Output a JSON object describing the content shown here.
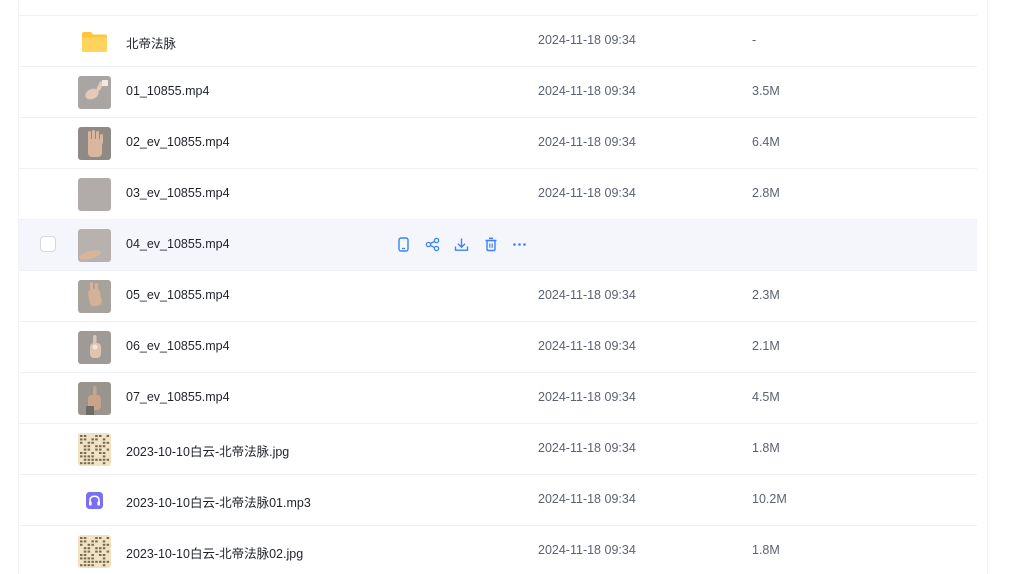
{
  "files": [
    {
      "name": "北帝法脉",
      "date": "2024-11-18 09:34",
      "size": "-",
      "kind": "folder"
    },
    {
      "name": "01_10855.mp4",
      "date": "2024-11-18 09:34",
      "size": "3.5M",
      "kind": "video",
      "thumb": "t1"
    },
    {
      "name": "02_ev_10855.mp4",
      "date": "2024-11-18 09:34",
      "size": "6.4M",
      "kind": "video",
      "thumb": "t2"
    },
    {
      "name": "03_ev_10855.mp4",
      "date": "2024-11-18 09:34",
      "size": "2.8M",
      "kind": "video",
      "thumb": "t3"
    },
    {
      "name": "04_ev_10855.mp4",
      "date": "",
      "size": "",
      "kind": "video",
      "thumb": "t4",
      "hovered": true
    },
    {
      "name": "05_ev_10855.mp4",
      "date": "2024-11-18 09:34",
      "size": "2.3M",
      "kind": "video",
      "thumb": "t5"
    },
    {
      "name": "06_ev_10855.mp4",
      "date": "2024-11-18 09:34",
      "size": "2.1M",
      "kind": "video",
      "thumb": "t6"
    },
    {
      "name": "07_ev_10855.mp4",
      "date": "2024-11-18 09:34",
      "size": "4.5M",
      "kind": "video",
      "thumb": "t7"
    },
    {
      "name": "2023-10-10白云-北帝法脉.jpg",
      "date": "2024-11-18 09:34",
      "size": "1.8M",
      "kind": "image",
      "thumb": "doc"
    },
    {
      "name": "2023-10-10白云-北帝法脉01.mp3",
      "date": "2024-11-18 09:34",
      "size": "10.2M",
      "kind": "audio"
    },
    {
      "name": "2023-10-10白云-北帝法脉02.jpg",
      "date": "2024-11-18 09:34",
      "size": "1.8M",
      "kind": "image",
      "thumb": "doc"
    }
  ],
  "hover_actions": [
    "phone-icon",
    "share-icon",
    "download-icon",
    "delete-icon",
    "more-icon"
  ],
  "colors": {
    "accent": "#3b82f6",
    "folder": "#fdc53f",
    "audio": "#7b6ef6",
    "hover_bg": "#f4f6fb"
  }
}
